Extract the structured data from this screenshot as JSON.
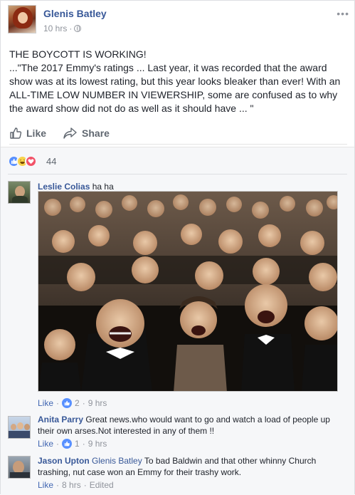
{
  "post": {
    "author": "Glenis Batley",
    "time": "10 hrs",
    "more_label": "•••",
    "body_line1": "THE BOYCOTT IS WORKING!",
    "body_line2": "...\"The 2017 Emmy's ratings ... Last year, it was recorded that the award show was at its lowest rating, but this year looks bleaker than ever! With an ALL-TIME LOW NUMBER IN VIEWERSHIP, some are confused as to why the award show did not do as well as it should have ... \""
  },
  "actions": {
    "like_label": "Like",
    "share_label": "Share"
  },
  "reactions": {
    "count": "44",
    "types": [
      "like-icon",
      "haha-icon",
      "love-icon"
    ]
  },
  "comments": [
    {
      "author": "Leslie Colias",
      "text": "ha ha",
      "like_label": "Like",
      "dot": "·",
      "likes": "2",
      "time": "9 hrs"
    },
    {
      "author": "Anita Parry",
      "text": "Great news.who would want to go and watch a load of people up their own arses.Not interested in any of them !!",
      "like_label": "Like",
      "dot": "·",
      "likes": "1",
      "time": "9 hrs"
    },
    {
      "author": "Jason Upton",
      "mention": "Glenis Batley",
      "text": "To bad Baldwin and that other whinny Church trashing, nut case won an Emmy for their trashy work.",
      "like_label": "Like",
      "dot": "·",
      "time": "8 hrs",
      "edited": "Edited"
    }
  ],
  "colors": {
    "link": "#385898",
    "meta": "#90949c",
    "like_blue": "#5890ff",
    "love_red": "#f25268",
    "haha_yellow": "#f7d24a",
    "panel_bg": "#f6f7f9"
  }
}
